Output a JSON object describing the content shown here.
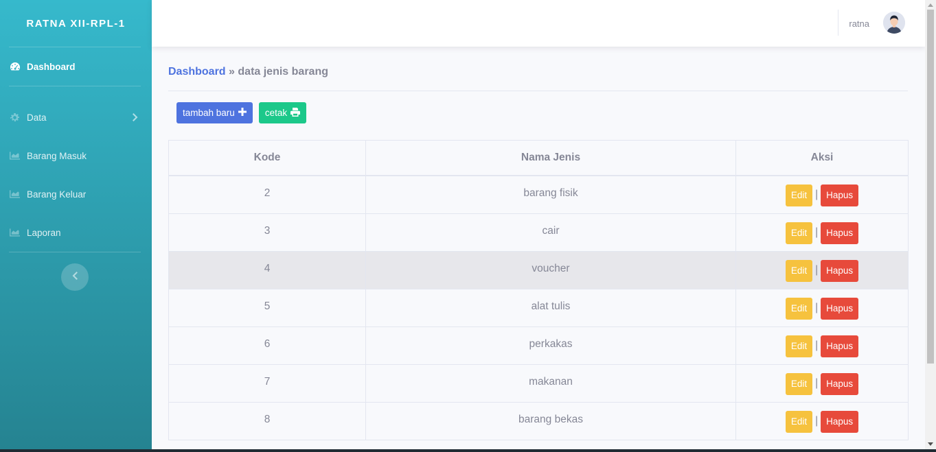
{
  "sidebar": {
    "brand": "RATNA XII-RPL-1",
    "items": [
      {
        "label": "Dashboard",
        "icon": "tachometer-icon"
      },
      {
        "label": "Data",
        "icon": "cog-icon"
      },
      {
        "label": "Barang Masuk",
        "icon": "chart-area-icon"
      },
      {
        "label": "Barang Keluar",
        "icon": "chart-area-icon"
      },
      {
        "label": "Laporan",
        "icon": "chart-area-icon"
      }
    ]
  },
  "topbar": {
    "username": "ratna"
  },
  "breadcrumb": {
    "home": "Dashboard",
    "separator": "»",
    "current": "data jenis barang"
  },
  "actions": {
    "add_label": "tambah baru",
    "print_label": "cetak"
  },
  "table": {
    "headers": [
      "Kode",
      "Nama Jenis",
      "Aksi"
    ],
    "rows": [
      {
        "kode": "2",
        "nama": "barang fisik"
      },
      {
        "kode": "3",
        "nama": "cair"
      },
      {
        "kode": "4",
        "nama": "voucher"
      },
      {
        "kode": "5",
        "nama": "alat tulis"
      },
      {
        "kode": "6",
        "nama": "perkakas"
      },
      {
        "kode": "7",
        "nama": "makanan"
      },
      {
        "kode": "8",
        "nama": "barang bekas"
      }
    ],
    "edit_label": "Edit",
    "delete_label": "Hapus",
    "action_separator": "|"
  },
  "colors": {
    "primary": "#4e73df",
    "success": "#1cc88a",
    "warning": "#f6c23e",
    "danger": "#e74a3b",
    "sidebar": "#36b9cc"
  }
}
